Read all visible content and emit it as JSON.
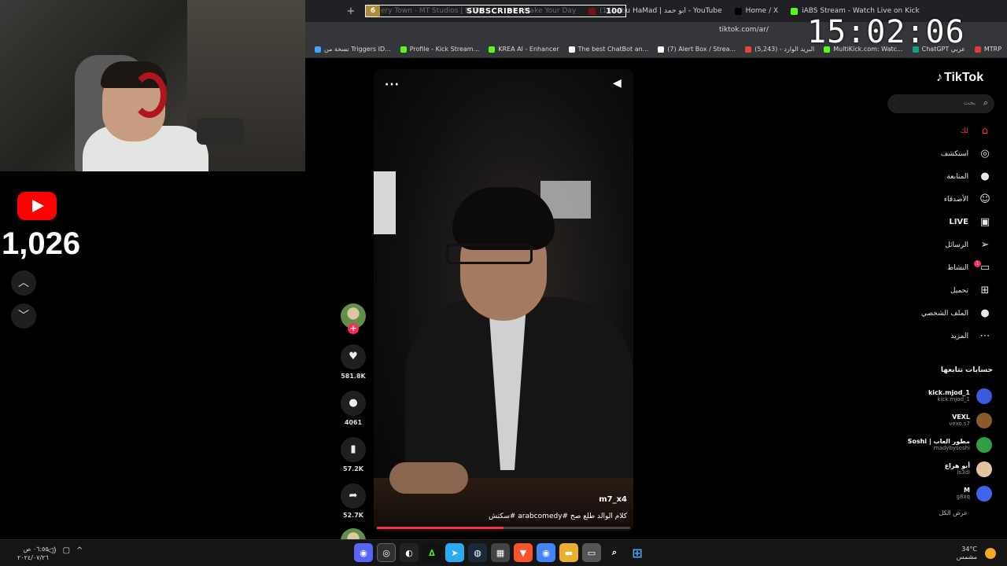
{
  "clock": "15:02:06",
  "subscriber_widget": {
    "goal": "6",
    "label": "SUBSCRIBERS",
    "count": "100"
  },
  "tabs": [
    {
      "label": "ery Town - MT Studios | MTRP",
      "color": "#b08b3a"
    },
    {
      "label": "ok - Make Your Day",
      "color": "#000000"
    },
    {
      "label": "(14) Abu HaMad | ابو حمد - YouTube",
      "color": "#ff0000"
    },
    {
      "label": "Home / X",
      "color": "#000000"
    },
    {
      "label": "iABS Stream - Watch Live on Kick",
      "color": "#53fc18"
    }
  ],
  "address": {
    "url": "tiktok.com/ar/"
  },
  "bookmarks": [
    {
      "label": "نسخة من Triggers ID...",
      "color": "#3ea6ff"
    },
    {
      "label": "Profile - Kick Stream...",
      "color": "#53fc18"
    },
    {
      "label": "KREA AI - Enhancer",
      "color": "#53fc18"
    },
    {
      "label": "The best ChatBot an...",
      "color": "#ffffff"
    },
    {
      "label": "(7) Alert Box / Strea...",
      "color": "#ffffff"
    },
    {
      "label": "البريد الوارد - (5,243)",
      "color": "#ea4335"
    },
    {
      "label": "MultiKick.com: Watc...",
      "color": "#53fc18"
    },
    {
      "label": "ChatGPT عربي",
      "color": "#10a37f"
    },
    {
      "label": "MTRP",
      "color": "#e53935"
    }
  ],
  "youtube": {
    "count": "1,026"
  },
  "video": {
    "author": "m7_x4",
    "caption": "كلام الوالد طلع صح #arabcomedy #سكتش",
    "progress": 0.5
  },
  "actions": {
    "likes": "581.8K",
    "comments": "4061",
    "saves": "57.2K",
    "shares": "52.7K"
  },
  "tiktok": {
    "logo": "TikTok",
    "search_placeholder": "بحث",
    "menu": [
      {
        "label": "لك",
        "icon": "⌂",
        "name": "home",
        "active": true
      },
      {
        "label": "استكشف",
        "icon": "◎",
        "name": "explore"
      },
      {
        "label": "المتابعة",
        "icon": "●",
        "name": "following"
      },
      {
        "label": "الأصدقاء",
        "icon": "☺",
        "name": "friends"
      },
      {
        "label": "LIVE",
        "icon": "▣",
        "name": "live"
      },
      {
        "label": "الرسائل",
        "icon": "➢",
        "name": "messages"
      },
      {
        "label": "النشاط",
        "icon": "▭",
        "name": "activity",
        "badge": "1"
      },
      {
        "label": "تحميل",
        "icon": "⊞",
        "name": "upload"
      },
      {
        "label": "الملف الشخصي",
        "icon": "●",
        "name": "profile"
      },
      {
        "label": "المزيد",
        "icon": "⋯",
        "name": "more"
      }
    ],
    "following_title": "حسابات تتابعها",
    "following": [
      {
        "name": "kick.mjod_1",
        "handle": "kick.mjod_1",
        "color": "#3b5bdb"
      },
      {
        "name": "VEXL",
        "handle": "vexo.s7",
        "color": "#8b5a2b"
      },
      {
        "name": "Soshi | مطور العاب",
        "handle": "madybysoshi",
        "color": "#2f9e44"
      },
      {
        "name": "أبو هزاع",
        "handle": "ls3dl",
        "color": "#e2c49f"
      },
      {
        "name": "M",
        "handle": "g8xq",
        "color": "#4263eb"
      }
    ],
    "see_all": "عرض الكل"
  },
  "taskbar": {
    "time": "٠٦:٥٥ ص",
    "date": "٢٠٢٤/٠٧/٢٦",
    "weather_temp": "34°C",
    "weather_text": "مشمس"
  }
}
